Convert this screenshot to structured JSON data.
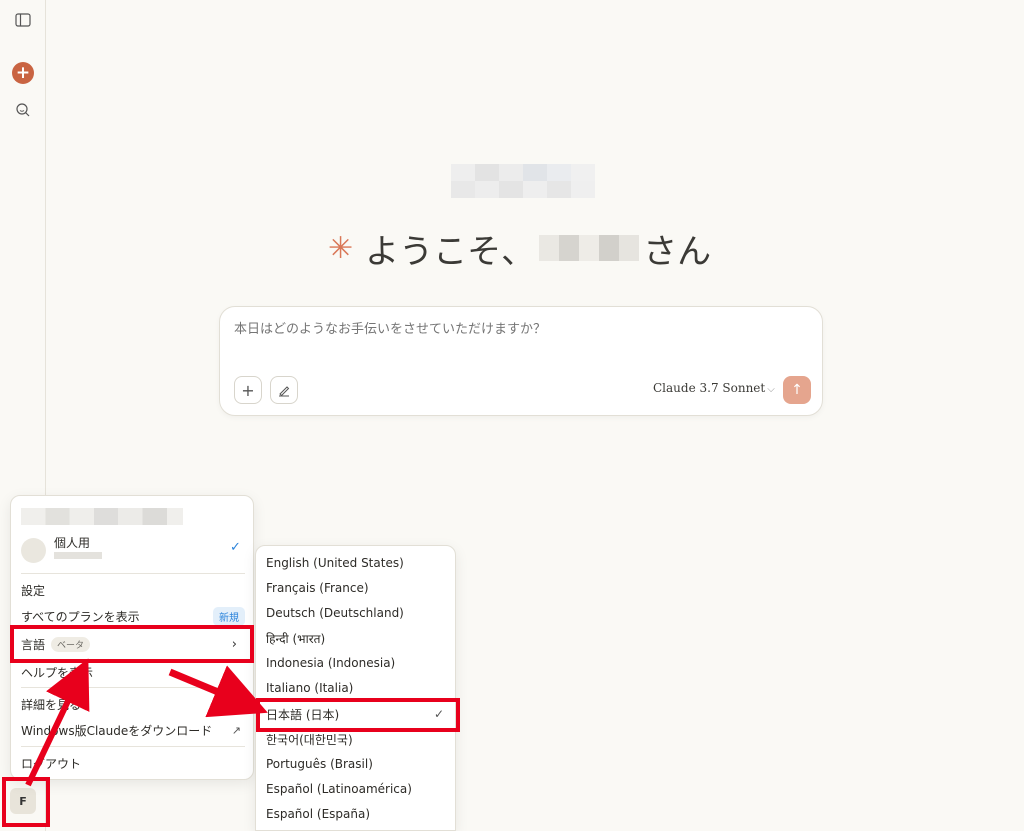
{
  "sidebar": {
    "toggle_icon": "sidebar-toggle-icon",
    "new_chat_icon": "plus-icon",
    "search_icon": "search-icon",
    "avatar_letter": "F"
  },
  "main": {
    "welcome_prefix": "ようこそ、",
    "welcome_suffix": "さん",
    "composer_placeholder": "本日はどのようなお手伝いをさせていただけますか？",
    "model_name": "Claude 3.7 Sonnet",
    "accent_color": "#c96442"
  },
  "account_menu": {
    "org_name": "個人用",
    "items": {
      "settings": "設定",
      "view_plans": "すべてのプランを表示",
      "new_badge": "新規",
      "language": "言語",
      "beta_badge": "ベータ",
      "help": "ヘルプを表示",
      "learn_more": "詳細を見る",
      "download": "Windows版Claudeをダウンロード",
      "logout": "ログアウト"
    }
  },
  "language_menu": {
    "options": [
      "English (United States)",
      "Français (France)",
      "Deutsch (Deutschland)",
      "हिन्दी (भारत)",
      "Indonesia (Indonesia)",
      "Italiano (Italia)",
      "日本語 (日本)",
      "한국어(대한민국)",
      "Português (Brasil)",
      "Español (Latinoamérica)",
      "Español (España)"
    ],
    "selected": "日本語 (日本)"
  },
  "annotation_color": "#e8001c"
}
